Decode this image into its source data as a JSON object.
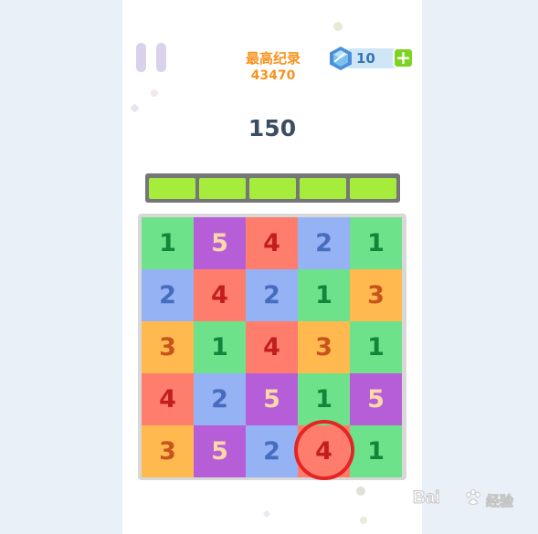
{
  "header": {
    "best_label": "最高纪录",
    "best_value": "43470",
    "gem_count": "10",
    "plus_label": "+",
    "pause_icon": "pause-icon",
    "gem_icon": "blue-gem-icon"
  },
  "score": "150",
  "progress": {
    "segments_filled": 5,
    "segments_total": 5
  },
  "board": {
    "rows": [
      [
        "1",
        "5",
        "4",
        "2",
        "1"
      ],
      [
        "2",
        "4",
        "2",
        "1",
        "3"
      ],
      [
        "3",
        "1",
        "4",
        "3",
        "1"
      ],
      [
        "4",
        "2",
        "5",
        "1",
        "5"
      ],
      [
        "3",
        "5",
        "2",
        "4",
        "1"
      ]
    ],
    "highlighted_tile": {
      "row": 5,
      "col": 4
    }
  },
  "colors": {
    "tile_1": "#6ee28a",
    "tile_2": "#95b2f4",
    "tile_3": "#ffb94f",
    "tile_4": "#ff7d6d",
    "tile_5": "#b65ed8",
    "progress_fill": "#a6ec3c",
    "highlight_ring": "#e62424",
    "best_score": "#f7931e"
  },
  "watermark": {
    "brand_left": "Bai",
    "brand_right": "经验",
    "paw_icon": "baidu-paw-icon"
  }
}
